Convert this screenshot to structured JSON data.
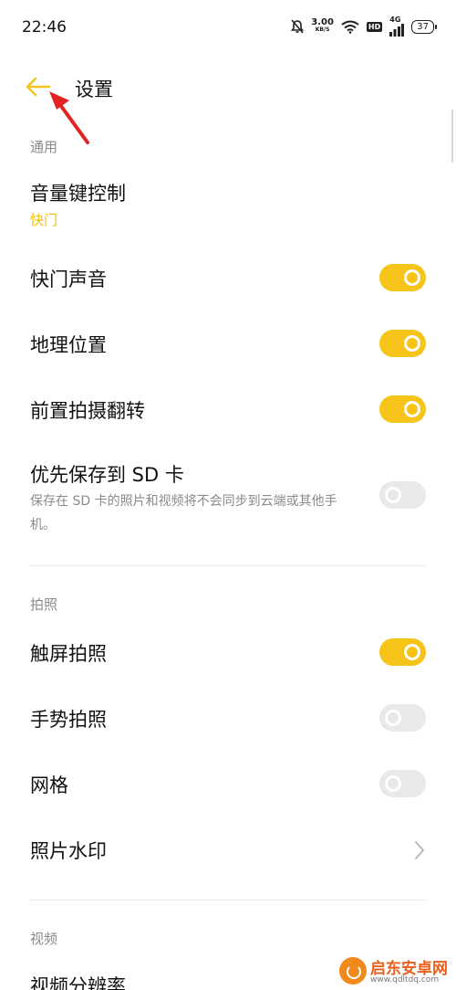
{
  "status_bar": {
    "time": "22:46",
    "net_speed_value": "3.00",
    "net_speed_unit": "KB/S",
    "hd_label": "HD",
    "network_label": "4G",
    "battery": "37"
  },
  "header": {
    "title": "设置",
    "accent_color": "#f6c319"
  },
  "sections": {
    "general": "通用",
    "photo": "拍照",
    "video": "视频"
  },
  "settings": {
    "volume_key": {
      "title": "音量键控制",
      "value": "快门"
    },
    "shutter_sound": {
      "title": "快门声音",
      "enabled": true
    },
    "location": {
      "title": "地理位置",
      "enabled": true
    },
    "front_mirror": {
      "title": "前置拍摄翻转",
      "enabled": true
    },
    "save_to_sd": {
      "title": "优先保存到 SD 卡",
      "description": "保存在 SD 卡的照片和视频将不会同步到云端或其他手机。",
      "enabled": false
    },
    "touch_capture": {
      "title": "触屏拍照",
      "enabled": true
    },
    "gesture_capture": {
      "title": "手势拍照",
      "enabled": false
    },
    "grid": {
      "title": "网格",
      "enabled": false
    },
    "watermark": {
      "title": "照片水印"
    },
    "video_resolution": {
      "title": "视频分辨率"
    }
  },
  "site_watermark": {
    "name": "启东安卓网",
    "url": "www.qdltdq.com"
  }
}
